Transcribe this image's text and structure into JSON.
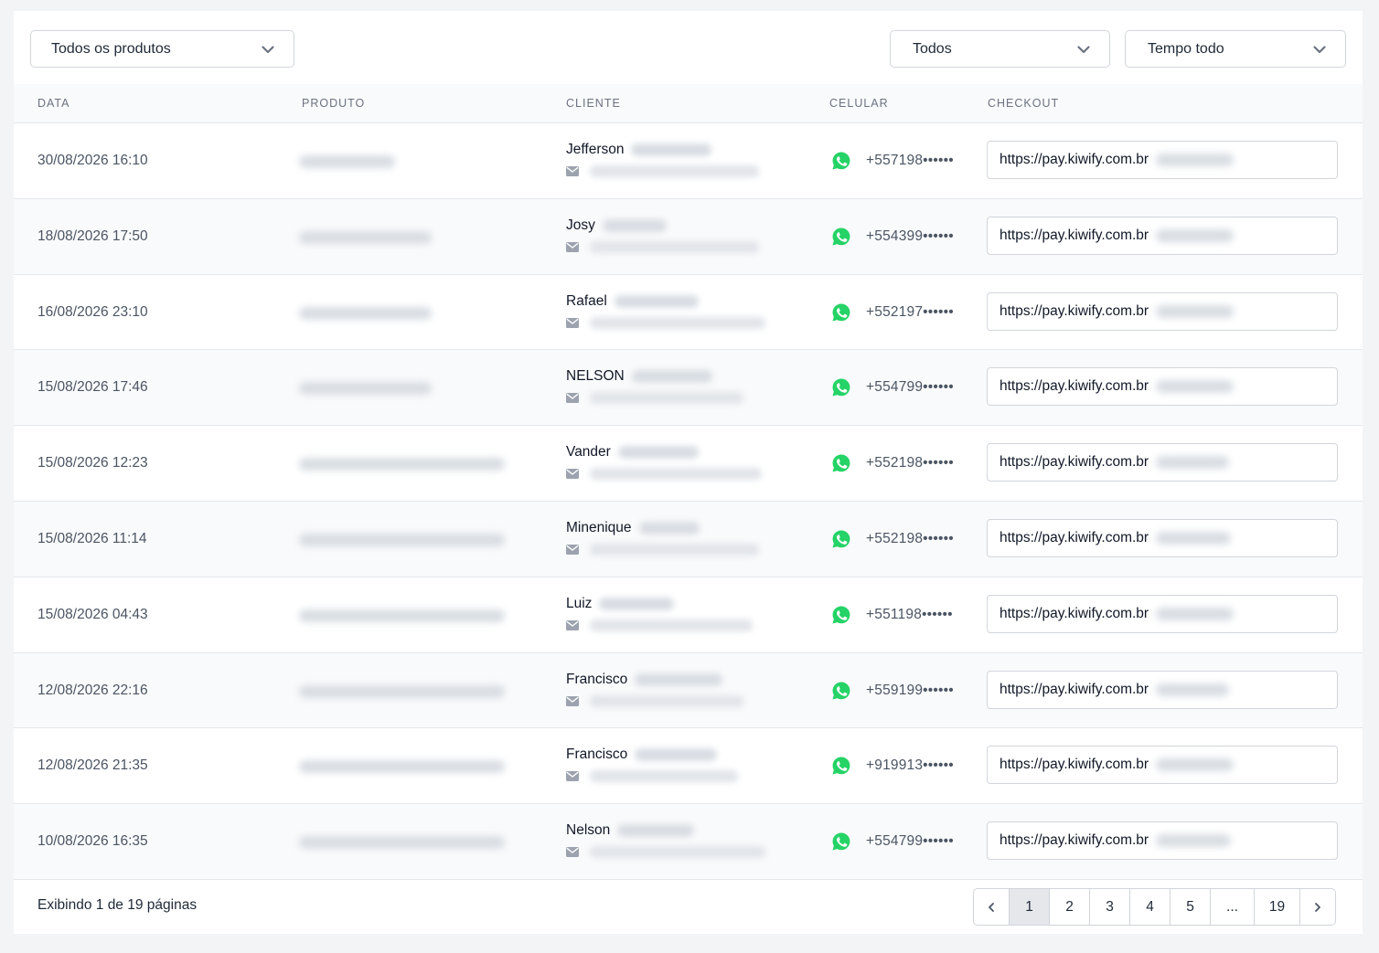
{
  "filters": {
    "products": "Todos os produtos",
    "status": "Todos",
    "period": "Tempo todo"
  },
  "table": {
    "headers": {
      "date": "DATA",
      "product": "PRODUTO",
      "client": "CLIENTE",
      "phone": "CELULAR",
      "checkout": "CHECKOUT"
    },
    "rows": [
      {
        "date": "30/08/2026 16:10",
        "client": "Jefferson",
        "phone": "+557198••••••",
        "checkout": "https://pay.kiwify.com.br"
      },
      {
        "date": "18/08/2026 17:50",
        "client": "Josy",
        "phone": "+554399••••••",
        "checkout": "https://pay.kiwify.com.br"
      },
      {
        "date": "16/08/2026 23:10",
        "client": "Rafael",
        "phone": "+552197••••••",
        "checkout": "https://pay.kiwify.com.br"
      },
      {
        "date": "15/08/2026 17:46",
        "client": "NELSON",
        "phone": "+554799••••••",
        "checkout": "https://pay.kiwify.com.br"
      },
      {
        "date": "15/08/2026 12:23",
        "client": "Vander",
        "phone": "+552198••••••",
        "checkout": "https://pay.kiwify.com.br"
      },
      {
        "date": "15/08/2026 11:14",
        "client": "Minenique",
        "phone": "+552198••••••",
        "checkout": "https://pay.kiwify.com.br"
      },
      {
        "date": "15/08/2026 04:43",
        "client": "Luiz",
        "phone": "+551198••••••",
        "checkout": "https://pay.kiwify.com.br"
      },
      {
        "date": "12/08/2026 22:16",
        "client": "Francisco",
        "phone": "+559199••••••",
        "checkout": "https://pay.kiwify.com.br"
      },
      {
        "date": "12/08/2026 21:35",
        "client": "Francisco",
        "phone": "+919913••••••",
        "checkout": "https://pay.kiwify.com.br"
      },
      {
        "date": "10/08/2026 16:35",
        "client": "Nelson",
        "phone": "+554799••••••",
        "checkout": "https://pay.kiwify.com.br"
      }
    ]
  },
  "footer": {
    "summary": "Exibindo 1 de 19 páginas"
  },
  "pagination": {
    "pages": [
      "1",
      "2",
      "3",
      "4",
      "5",
      "...",
      "19"
    ],
    "current": "1"
  },
  "colors": {
    "whatsapp": "#25d366",
    "border": "#d1d5db"
  }
}
